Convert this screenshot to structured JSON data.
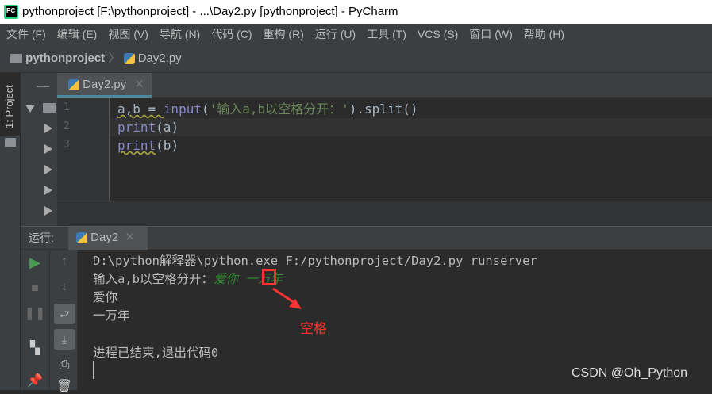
{
  "title": "pythonproject [F:\\pythonproject] - ...\\Day2.py [pythonproject] - PyCharm",
  "logo": "PC",
  "menu": [
    "文件 (F)",
    "编辑 (E)",
    "视图 (V)",
    "导航 (N)",
    "代码 (C)",
    "重构 (R)",
    "运行 (U)",
    "工具 (T)",
    "VCS (S)",
    "窗口 (W)",
    "帮助 (H)"
  ],
  "breadcrumb": {
    "project": "pythonproject",
    "file": "Day2.py"
  },
  "tool_window": "1: Project",
  "editor": {
    "tab": "Day2.py",
    "line_numbers": [
      "1",
      "2",
      "3"
    ],
    "lines": [
      {
        "a": "a,b = ",
        "b": "input",
        "c": "(",
        "d": "'输入a,b以空格分开：'",
        "e": ").split()"
      },
      {
        "a": "print",
        "b": "(a)"
      },
      {
        "a": "print",
        "b": "(b)"
      }
    ]
  },
  "run": {
    "label": "运行:",
    "tab": "Day2",
    "console": {
      "cmd": "D:\\python解释器\\python.exe F:/pythonproject/Day2.py runserver",
      "prompt": "输入a,b以空格分开：",
      "input": "爱你 一万年",
      "out1": "爱你",
      "out2": "一万年",
      "exit": "进程已结束,退出代码0"
    }
  },
  "annotation": "空格",
  "watermark": "CSDN @Oh_Python",
  "colors": {
    "annotation": "#ff3333",
    "input_text": "#2e8a2e"
  }
}
